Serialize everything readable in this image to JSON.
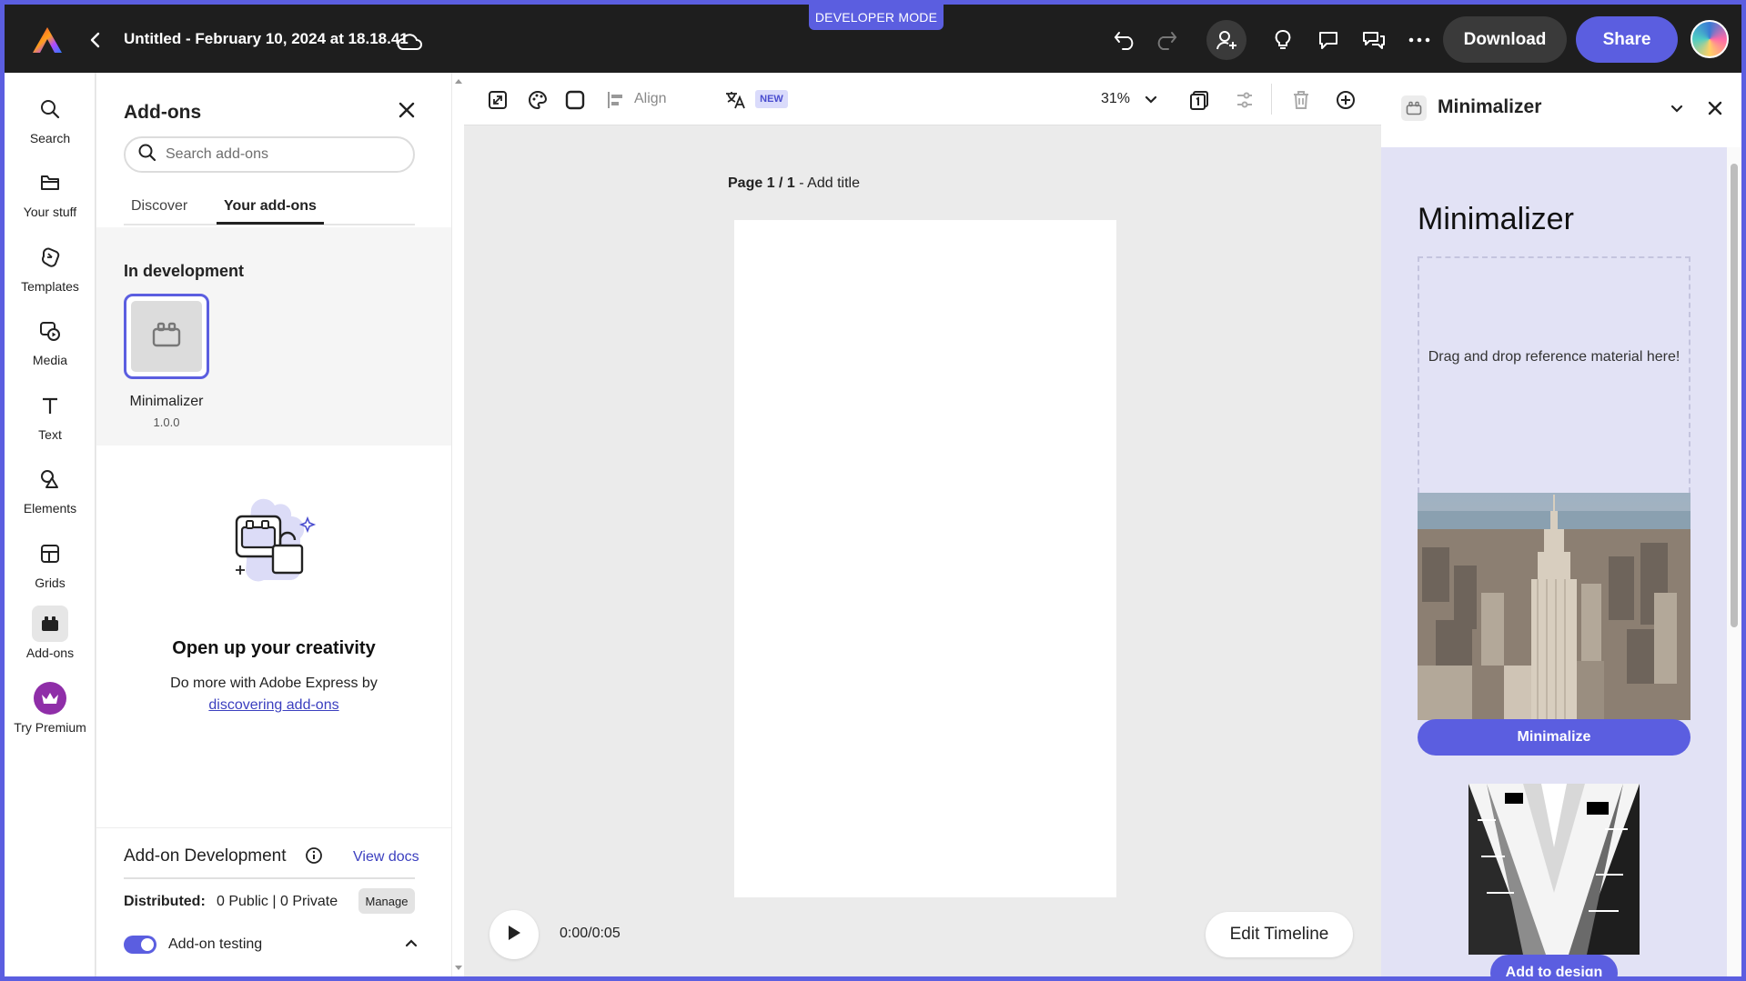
{
  "topbar": {
    "developer_mode": "DEVELOPER MODE",
    "doc_title": "Untitled - February 10, 2024 at 18.18.41",
    "download_label": "Download",
    "share_label": "Share"
  },
  "rail": {
    "items": [
      {
        "label": "Search",
        "icon": "search-icon"
      },
      {
        "label": "Your stuff",
        "icon": "folder-icon"
      },
      {
        "label": "Templates",
        "icon": "templates-icon"
      },
      {
        "label": "Media",
        "icon": "media-icon"
      },
      {
        "label": "Text",
        "icon": "text-icon"
      },
      {
        "label": "Elements",
        "icon": "elements-icon"
      },
      {
        "label": "Grids",
        "icon": "grids-icon"
      },
      {
        "label": "Add-ons",
        "icon": "addons-icon"
      },
      {
        "label": "Try Premium",
        "icon": "crown-icon"
      }
    ],
    "active": "Add-ons"
  },
  "addons_panel": {
    "title": "Add-ons",
    "search_placeholder": "Search add-ons",
    "tabs": [
      "Discover",
      "Your add-ons"
    ],
    "active_tab": "Your add-ons",
    "in_development": {
      "heading": "In development",
      "addon_name": "Minimalizer",
      "addon_version": "1.0.0"
    },
    "empty_state": {
      "title": "Open up your creativity",
      "desc_prefix": "Do more with Adobe Express by",
      "link_text": "discovering add-ons"
    },
    "dev": {
      "title": "Add-on Development",
      "view_docs": "View docs",
      "distributed_label": "Distributed:",
      "distributed_value": "0 Public | 0 Private",
      "manage_label": "Manage",
      "testing_label": "Add-on testing",
      "testing_on": true
    }
  },
  "toolbar": {
    "align_label": "Align",
    "new_badge": "NEW",
    "zoom": "31%"
  },
  "canvas": {
    "page_num": "Page 1 / 1",
    "page_sep": " - ",
    "page_title_placeholder": "Add title",
    "time": "0:00/0:05",
    "edit_timeline": "Edit Timeline"
  },
  "right_panel": {
    "title": "Minimalizer",
    "heading": "Minimalizer",
    "dropzone_text": "Drag and drop reference material here!",
    "minimalize_label": "Minimalize",
    "add_to_design_label": "Add to design"
  },
  "colors": {
    "accent": "#5b5ee0",
    "topbar": "#1e1e1e",
    "link": "#3b3fbf"
  }
}
